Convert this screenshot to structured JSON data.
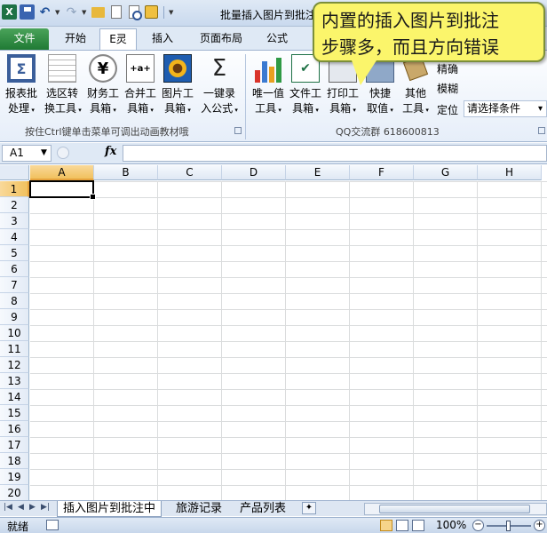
{
  "window": {
    "title": "批量插入图片到批注"
  },
  "qat": {
    "icons": [
      "excel-logo",
      "save-icon",
      "undo-icon",
      "redo-icon",
      "open-icon",
      "new-icon",
      "print-preview-icon",
      "wizard-icon"
    ]
  },
  "tabs": {
    "file": "文件",
    "items": [
      {
        "label": "开始"
      },
      {
        "label": "E灵"
      },
      {
        "label": "插入"
      },
      {
        "label": "页面布局"
      },
      {
        "label": "公式"
      }
    ]
  },
  "ribbon": {
    "buttons": [
      {
        "line1": "报表批",
        "line2": "处理"
      },
      {
        "line1": "选区转",
        "line2": "换工具"
      },
      {
        "line1": "财务工",
        "line2": "具箱"
      },
      {
        "line1": "合并工",
        "line2": "具箱"
      },
      {
        "line1": "图片工",
        "line2": "具箱"
      },
      {
        "line1": "一键录",
        "line2": "入公式"
      },
      {
        "line1": "唯一值",
        "line2": "工具"
      },
      {
        "line1": "文件工",
        "line2": "具箱"
      },
      {
        "line1": "打印工",
        "line2": "具箱"
      },
      {
        "line1": "快捷",
        "line2": "取值"
      },
      {
        "line1": "其他",
        "line2": "工具"
      }
    ],
    "side_items": {
      "precise": "精确",
      "fuzzy": "模糊",
      "locate": "定位",
      "select_condition": "请选择条件"
    },
    "group1_label": "按住Ctrl键单击菜单可调出动画教材哦",
    "group2_label": "QQ交流群  618600813",
    "icon_colors": {
      "file_tab": "#1f7a34",
      "chart_bars": [
        "#d9342b",
        "#3a7ad1",
        "#e8a020",
        "#2f9a45"
      ]
    }
  },
  "callout": {
    "line1": "内置的插入图片到批注",
    "line2": "步骤多，而且方向错误",
    "color": "#fbf56b"
  },
  "formula_bar": {
    "name_box": "A1",
    "fx": "fx",
    "value": ""
  },
  "grid": {
    "columns": [
      "A",
      "B",
      "C",
      "D",
      "E",
      "F",
      "G",
      "H"
    ],
    "rows": [
      "1",
      "2",
      "3",
      "4",
      "5",
      "6",
      "7",
      "8",
      "9",
      "10",
      "11",
      "12",
      "13",
      "14",
      "15",
      "16",
      "17",
      "18",
      "19",
      "20"
    ],
    "selected_cell": "A1"
  },
  "sheets": {
    "tabs": [
      {
        "label": "插入图片到批注中"
      },
      {
        "label": "旅游记录"
      },
      {
        "label": "产品列表"
      }
    ],
    "active_index": 0
  },
  "status": {
    "ready": "就绪",
    "zoom": "100%"
  }
}
